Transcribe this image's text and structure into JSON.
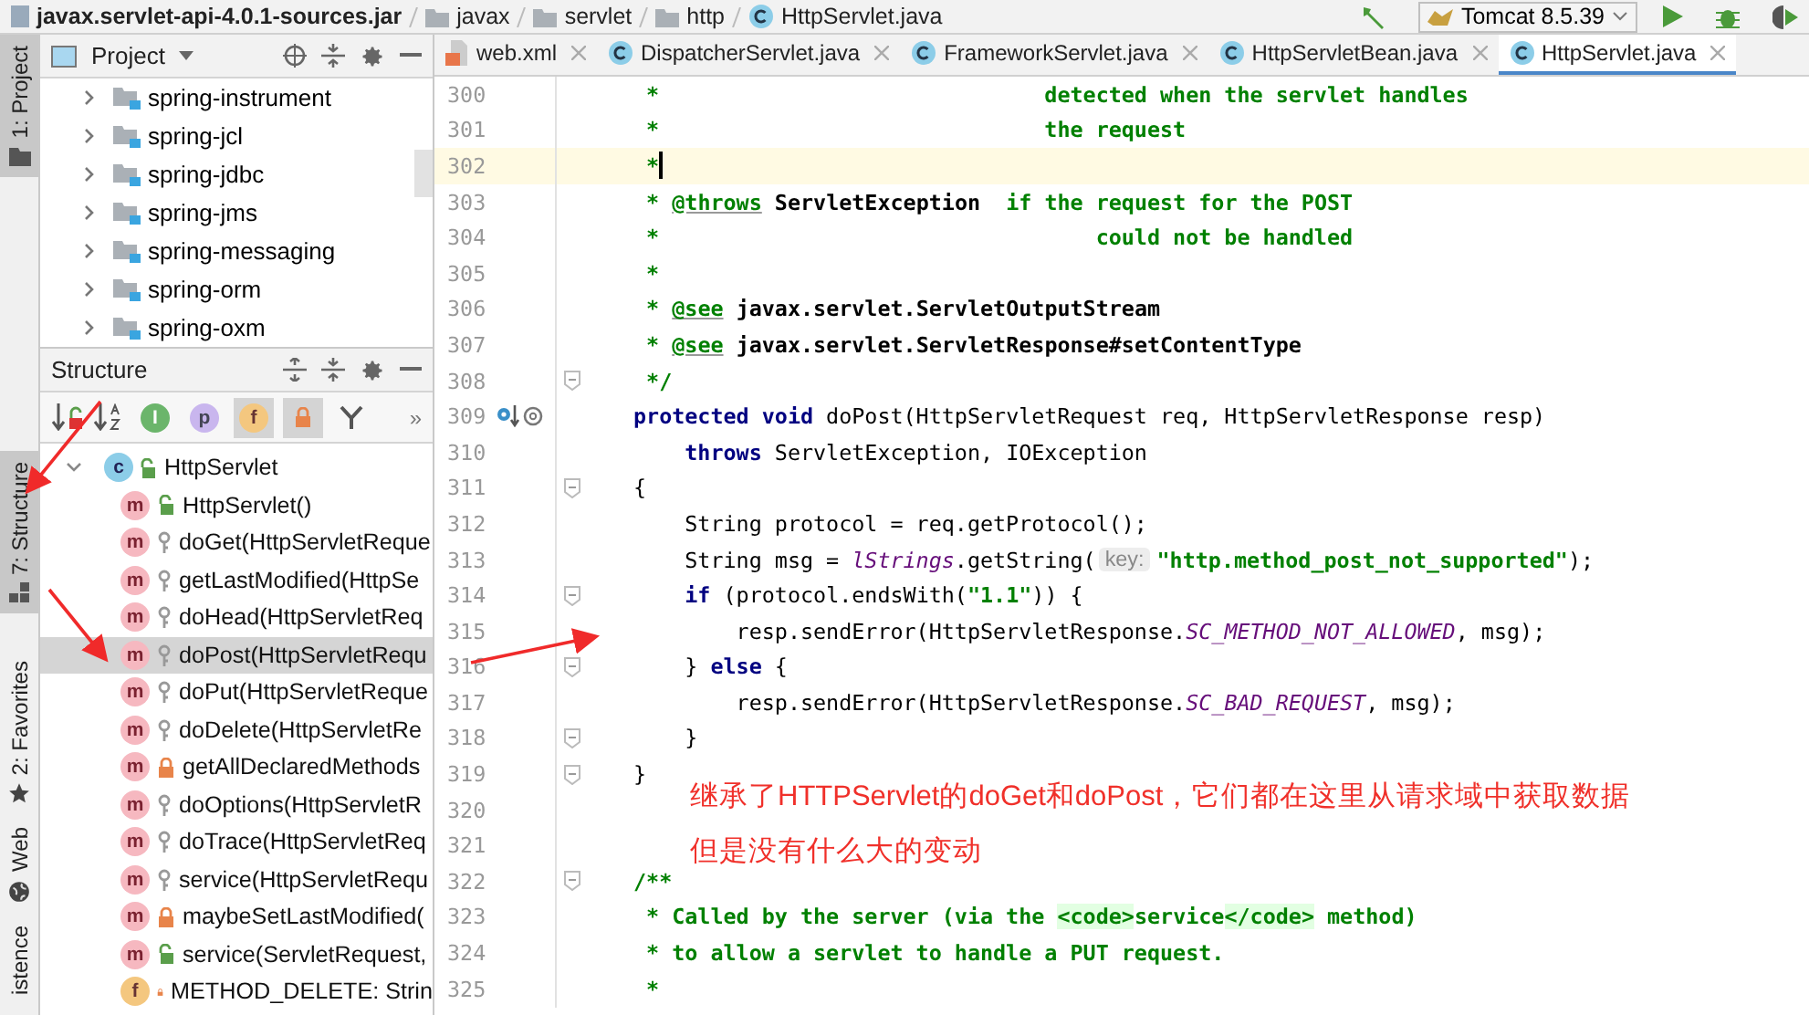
{
  "breadcrumb": [
    "javax.servlet-api-4.0.1-sources.jar",
    "javax",
    "servlet",
    "http",
    "HttpServlet.java"
  ],
  "run_config": "Tomcat 8.5.39",
  "side_tabs": [
    {
      "label": "1: Project",
      "kind": "project",
      "selected": true
    },
    {
      "label": "7: Structure",
      "kind": "structure",
      "selected": true
    },
    {
      "label": "2: Favorites",
      "kind": "favorites",
      "selected": false
    },
    {
      "label": "Web",
      "kind": "web",
      "selected": false
    },
    {
      "label": "istence",
      "kind": "persistence",
      "selected": false
    }
  ],
  "project_panel": {
    "title": "Project",
    "items": [
      "spring-instrument",
      "spring-jcl",
      "spring-jdbc",
      "spring-jms",
      "spring-messaging",
      "spring-orm",
      "spring-oxm"
    ]
  },
  "structure_panel": {
    "title": "Structure",
    "filters": [
      {
        "kind": "inherited",
        "label": "I",
        "on": false
      },
      {
        "kind": "properties",
        "label": "p",
        "on": false
      },
      {
        "kind": "fields",
        "label": "f",
        "on": true
      },
      {
        "kind": "non-public",
        "on": true
      }
    ],
    "more": "»",
    "root": {
      "label": "HttpServlet",
      "badge": "c",
      "kind": "public-class",
      "expanded": true,
      "children": [
        {
          "label": "HttpServlet()",
          "badge": "m",
          "kind": "public-method",
          "selected": false
        },
        {
          "label": "doGet(HttpServletReque",
          "badge": "m",
          "kind": "protected-method",
          "selected": false
        },
        {
          "label": "getLastModified(HttpSe",
          "badge": "m",
          "kind": "protected-method",
          "selected": false
        },
        {
          "label": "doHead(HttpServletReq",
          "badge": "m",
          "kind": "protected-method",
          "selected": false
        },
        {
          "label": "doPost(HttpServletRequ",
          "badge": "m",
          "kind": "protected-method",
          "selected": true
        },
        {
          "label": "doPut(HttpServletReque",
          "badge": "m",
          "kind": "protected-method",
          "selected": false
        },
        {
          "label": "doDelete(HttpServletRe",
          "badge": "m",
          "kind": "protected-method",
          "selected": false
        },
        {
          "label": "getAllDeclaredMethods",
          "badge": "m",
          "kind": "private-method",
          "selected": false
        },
        {
          "label": "doOptions(HttpServletR",
          "badge": "m",
          "kind": "protected-method",
          "selected": false
        },
        {
          "label": "doTrace(HttpServletReq",
          "badge": "m",
          "kind": "protected-method",
          "selected": false
        },
        {
          "label": "service(HttpServletRequ",
          "badge": "m",
          "kind": "protected-method",
          "selected": false
        },
        {
          "label": "maybeSetLastModified(",
          "badge": "m",
          "kind": "private-method",
          "selected": false
        },
        {
          "label": "service(ServletRequest,",
          "badge": "m",
          "kind": "public-method",
          "selected": false
        },
        {
          "label": "METHOD_DELETE: Strin",
          "badge": "f",
          "kind": "private-field",
          "selected": false
        }
      ]
    }
  },
  "tabs": [
    {
      "label": "web.xml",
      "kind": "xml",
      "selected": false
    },
    {
      "label": "DispatcherServlet.java",
      "kind": "class",
      "selected": false
    },
    {
      "label": "FrameworkServlet.java",
      "kind": "class",
      "selected": false
    },
    {
      "label": "HttpServletBean.java",
      "kind": "class",
      "selected": false
    },
    {
      "label": "HttpServlet.java",
      "kind": "class",
      "selected": true
    }
  ],
  "editor": {
    "lines": [
      {
        "number": "300",
        "segments": [
          {
            "kind": "comment",
            "text": " *                              detected when the servlet handles"
          }
        ]
      },
      {
        "number": "301",
        "segments": [
          {
            "kind": "comment",
            "text": " *                              the request"
          }
        ]
      },
      {
        "number": "302",
        "current": true,
        "segments": [
          {
            "kind": "comment",
            "text": " *"
          }
        ]
      },
      {
        "number": "303",
        "segments": [
          {
            "kind": "comment",
            "text": " * "
          },
          {
            "kind": "doctag",
            "text": "@throws"
          },
          {
            "kind": "ref",
            "text": " ServletException"
          },
          {
            "kind": "comment",
            "text": "  if the request for the POST"
          }
        ]
      },
      {
        "number": "304",
        "segments": [
          {
            "kind": "comment",
            "text": " *                                  could not be handled"
          }
        ]
      },
      {
        "number": "305",
        "segments": [
          {
            "kind": "comment",
            "text": " *"
          }
        ]
      },
      {
        "number": "306",
        "segments": [
          {
            "kind": "comment",
            "text": " * "
          },
          {
            "kind": "doctag",
            "text": "@see"
          },
          {
            "kind": "ref",
            "text": " javax.servlet.ServletOutputStream"
          }
        ]
      },
      {
        "number": "307",
        "segments": [
          {
            "kind": "comment",
            "text": " * "
          },
          {
            "kind": "doctag",
            "text": "@see"
          },
          {
            "kind": "ref",
            "text": " javax.servlet.ServletResponse#setContentType"
          }
        ]
      },
      {
        "number": "308",
        "fold": true,
        "segments": [
          {
            "kind": "comment",
            "text": " */"
          }
        ]
      },
      {
        "number": "309",
        "kind": "override",
        "segments": [
          {
            "kind": "keyword",
            "text": "protected void"
          },
          {
            "kind": "plain",
            "text": " doPost(HttpServletRequest req, HttpServletResponse resp)"
          }
        ]
      },
      {
        "number": "310",
        "segments": [
          {
            "kind": "keyword",
            "text": "    throws"
          },
          {
            "kind": "plain",
            "text": " ServletException, IOException"
          }
        ]
      },
      {
        "number": "311",
        "fold": true,
        "segments": [
          {
            "kind": "plain",
            "text": "{"
          }
        ]
      },
      {
        "number": "312",
        "segments": [
          {
            "kind": "plain",
            "text": "    String protocol = req.getProtocol();"
          }
        ]
      },
      {
        "number": "313",
        "segments": [
          {
            "kind": "plain",
            "text": "    String msg = "
          },
          {
            "kind": "static",
            "text": "lStrings"
          },
          {
            "kind": "plain",
            "text": ".getString("
          },
          {
            "kind": "hint",
            "text": "key:"
          },
          {
            "kind": "string",
            "text": "\"http.method_post_not_supported\""
          },
          {
            "kind": "plain",
            "text": ");"
          }
        ]
      },
      {
        "number": "314",
        "fold": true,
        "segments": [
          {
            "kind": "keyword",
            "text": "    if"
          },
          {
            "kind": "plain",
            "text": " (protocol.endsWith("
          },
          {
            "kind": "string",
            "text": "\"1.1\""
          },
          {
            "kind": "plain",
            "text": ")) {"
          }
        ]
      },
      {
        "number": "315",
        "segments": [
          {
            "kind": "plain",
            "text": "        resp.sendError(HttpServletResponse."
          },
          {
            "kind": "static",
            "text": "SC_METHOD_NOT_ALLOWED"
          },
          {
            "kind": "plain",
            "text": ", msg);"
          }
        ]
      },
      {
        "number": "316",
        "fold": true,
        "segments": [
          {
            "kind": "plain",
            "text": "    } "
          },
          {
            "kind": "keyword",
            "text": "else"
          },
          {
            "kind": "plain",
            "text": " {"
          }
        ]
      },
      {
        "number": "317",
        "segments": [
          {
            "kind": "plain",
            "text": "        resp.sendError(HttpServletResponse."
          },
          {
            "kind": "static",
            "text": "SC_BAD_REQUEST"
          },
          {
            "kind": "plain",
            "text": ", msg);"
          }
        ]
      },
      {
        "number": "318",
        "fold": true,
        "segments": [
          {
            "kind": "plain",
            "text": "    }"
          }
        ]
      },
      {
        "number": "319",
        "fold": true,
        "segments": [
          {
            "kind": "plain",
            "text": "}"
          }
        ]
      },
      {
        "number": "320"
      },
      {
        "number": "321"
      },
      {
        "number": "322",
        "fold": true,
        "segments": [
          {
            "kind": "comment",
            "text": "/**"
          }
        ]
      },
      {
        "number": "323",
        "segments": [
          {
            "kind": "comment",
            "text": " * Called by the server (via the "
          },
          {
            "kind": "codetag",
            "text": "<code>"
          },
          {
            "kind": "comment",
            "text": "service"
          },
          {
            "kind": "codetag",
            "text": "</code>"
          },
          {
            "kind": "comment",
            "text": " method)"
          }
        ]
      },
      {
        "number": "324",
        "segments": [
          {
            "kind": "comment",
            "text": " * to allow a servlet to handle a PUT request."
          }
        ]
      },
      {
        "number": "325",
        "segments": [
          {
            "kind": "comment",
            "text": " *"
          }
        ]
      }
    ]
  },
  "annotation": {
    "lines": [
      "继承了HTTPServlet的doGet和doPost，它们都在这里从请求域中获取数据",
      "但是没有什么大的变动"
    ]
  }
}
